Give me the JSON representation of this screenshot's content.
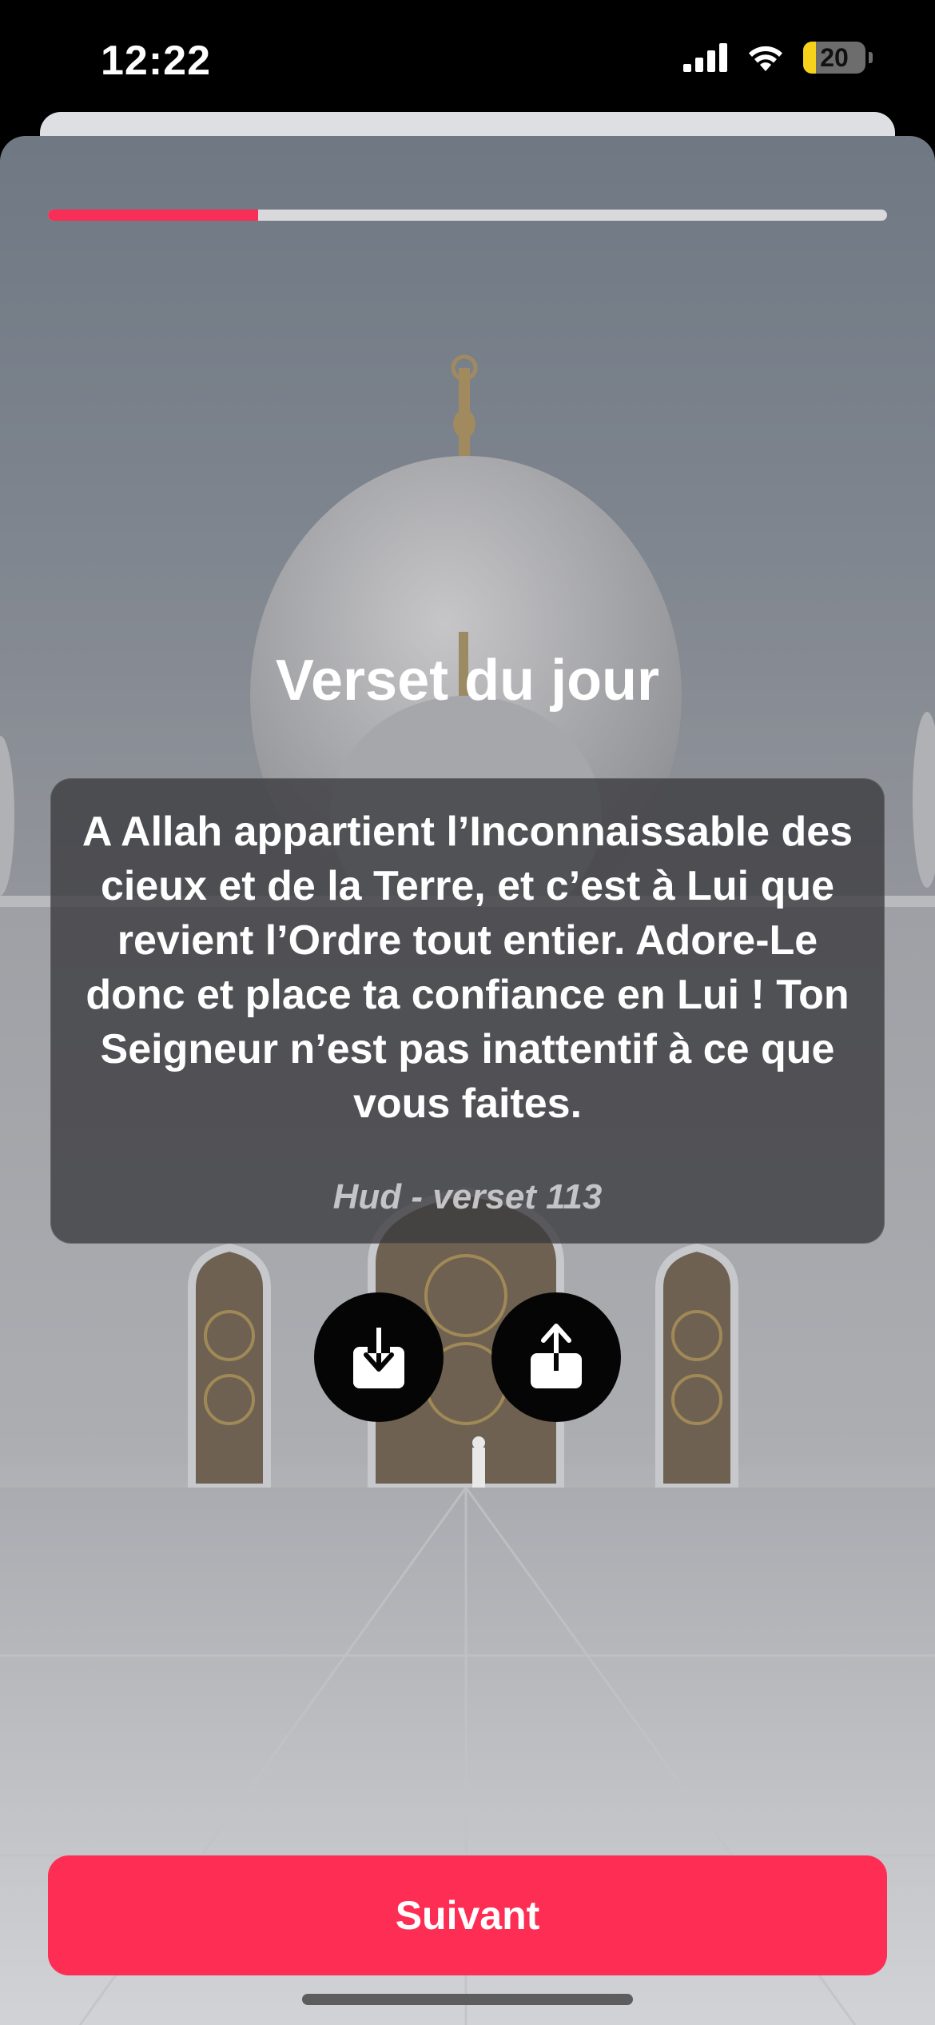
{
  "status_bar": {
    "time": "12:22",
    "battery_level": "20",
    "icons": [
      "cellular-signal-icon",
      "wifi-icon",
      "battery-icon"
    ]
  },
  "progress": {
    "fraction": 0.25
  },
  "verse": {
    "heading": "Verset du jour",
    "text": "A Allah appartient l’Inconnaissable des cieux et de la Terre, et c’est à Lui que revient l’Ordre tout entier. Adore-Le donc et place ta confiance en Lui ! Ton Seigneur n’est pas inattentif à ce que vous faites.",
    "reference": "Hud - verset 113"
  },
  "actions": {
    "download_icon": "download-icon",
    "share_icon": "share-icon"
  },
  "footer": {
    "next_label": "Suivant"
  },
  "colors": {
    "accent": "#fd2d54",
    "progress_fill": "#f72e55",
    "progress_track": "#d9d9db",
    "battery": "#f7d21a"
  }
}
